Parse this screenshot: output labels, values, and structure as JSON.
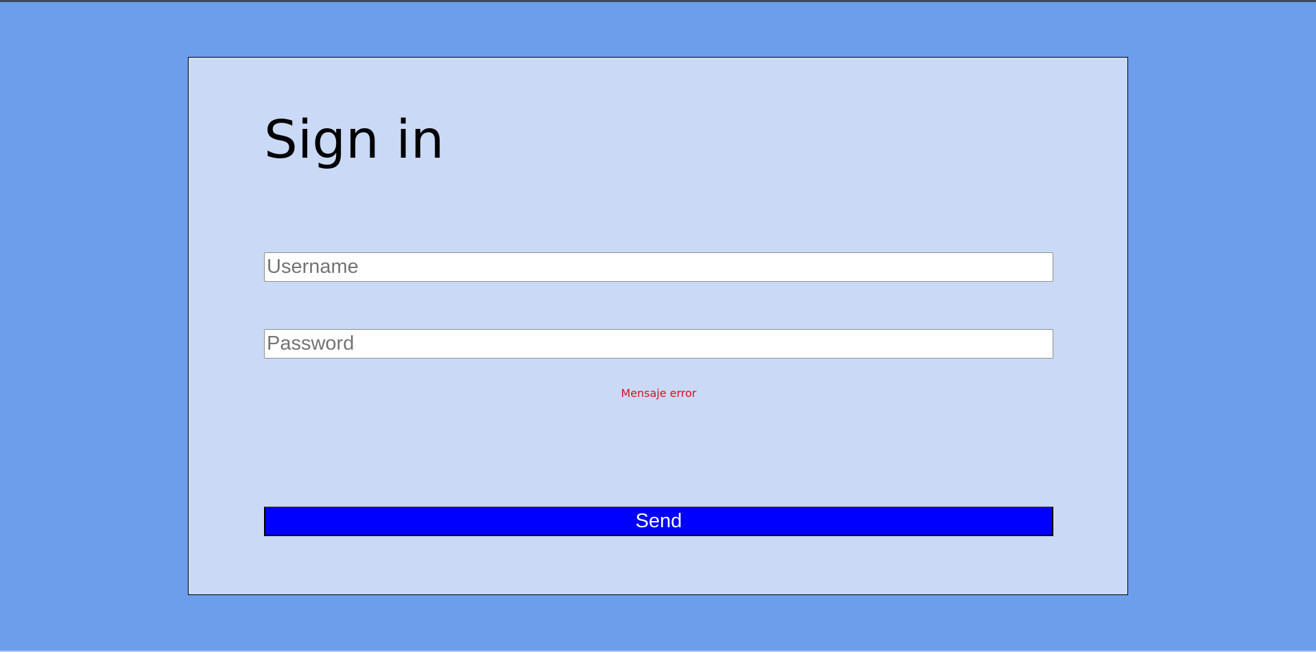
{
  "colors": {
    "page_background": "#6d9eeb",
    "card_background": "#c9d9f6",
    "button_background": "#0000ff",
    "button_text": "#ffffff",
    "error_text": "#e0101a"
  },
  "form": {
    "title": "Sign in",
    "username": {
      "value": "",
      "placeholder": "Username"
    },
    "password": {
      "value": "",
      "placeholder": "Password"
    },
    "error_message": "Mensaje error",
    "submit_label": "Send"
  }
}
